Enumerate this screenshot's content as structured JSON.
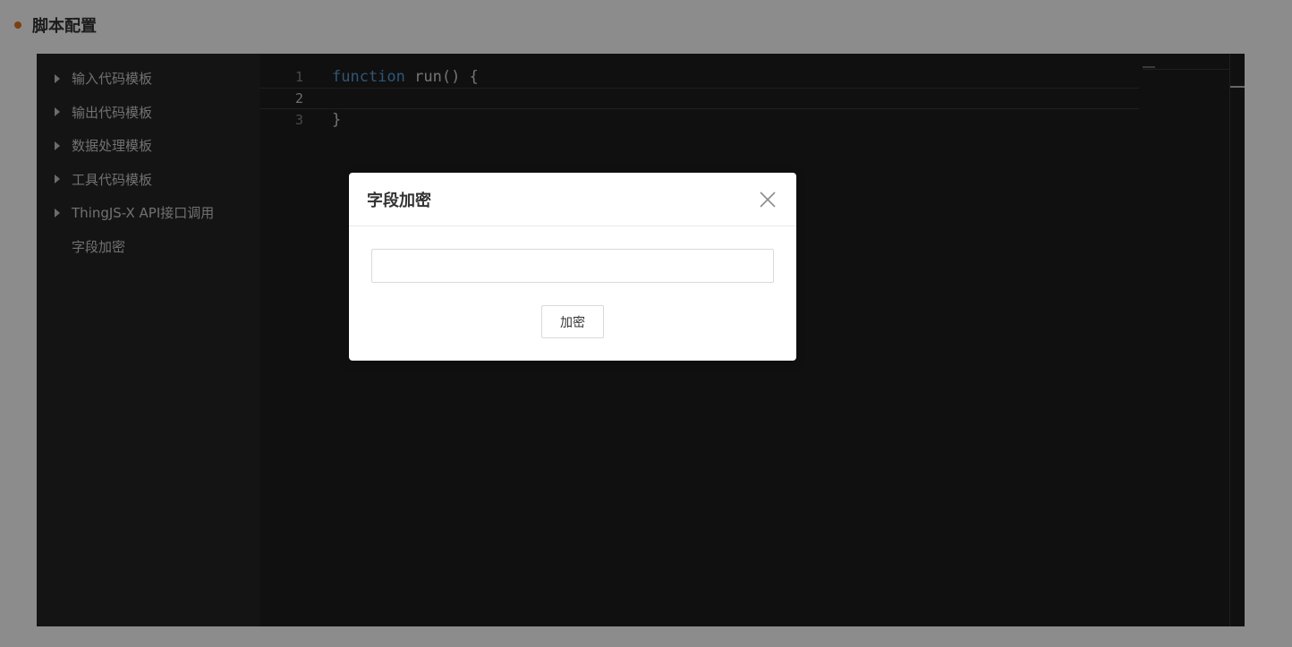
{
  "colors": {
    "accent": "#e27525",
    "mask": "rgba(0,0,0,0.45)",
    "editor_bg": "#1e1e1e",
    "sidebar_bg": "#252526",
    "keyword": "#569cd6"
  },
  "section": {
    "title": "脚本配置"
  },
  "template_tree": {
    "items": [
      {
        "label": "输入代码模板",
        "expandable": true
      },
      {
        "label": "输出代码模板",
        "expandable": true
      },
      {
        "label": "数据处理模板",
        "expandable": true
      },
      {
        "label": "工具代码模板",
        "expandable": true
      },
      {
        "label": "ThingJS-X API接口调用",
        "expandable": true
      },
      {
        "label": "字段加密",
        "expandable": false
      }
    ]
  },
  "editor": {
    "active_line": 2,
    "lines": [
      {
        "number": "1",
        "keyword": "function",
        "rest": " run() {"
      },
      {
        "number": "2",
        "keyword": "",
        "rest": ""
      },
      {
        "number": "3",
        "keyword": "",
        "rest": "}"
      }
    ]
  },
  "dialog": {
    "title": "字段加密",
    "close_icon": "close-icon",
    "input_value": "",
    "input_placeholder": "",
    "button_label": "加密"
  }
}
